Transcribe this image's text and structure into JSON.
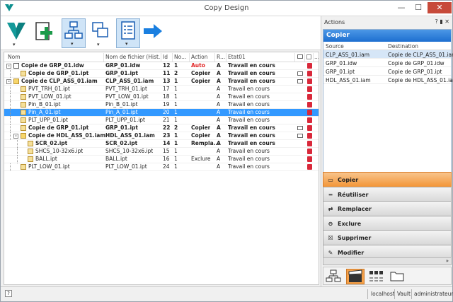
{
  "window": {
    "title": "Copy Design",
    "minimize": "—",
    "maximize": "☐",
    "close": "✕"
  },
  "toolbar": {
    "buttons": [
      {
        "name": "vault-menu",
        "icon": "vault-logo-icon"
      },
      {
        "name": "add",
        "icon": "add-plus-icon"
      },
      {
        "name": "tree-view",
        "icon": "tree-structure-icon"
      },
      {
        "name": "copy",
        "icon": "copy-windows-icon"
      },
      {
        "name": "list-view",
        "icon": "list-view-icon"
      },
      {
        "name": "next",
        "icon": "arrow-right-icon"
      }
    ]
  },
  "grid": {
    "headers": {
      "name": "Nom",
      "filename": "Nom de fichier (Hist...",
      "id": "Id",
      "no": "No...",
      "action": "Action",
      "r": "R...",
      "state": "Etat01",
      "more": "..."
    },
    "rows": [
      {
        "name": "Copie de GRP_01.idw",
        "file": "GRP_01.idw",
        "id": "12",
        "no": "1",
        "action": "Auto",
        "r": "A",
        "state": "Travail en cours",
        "bold": true,
        "red": true,
        "level": 0,
        "type": "drw",
        "exp": "-",
        "doc": false
      },
      {
        "name": "Copie de GRP_01.ipt",
        "file": "GRP_01.ipt",
        "id": "11",
        "no": "2",
        "action": "Copier",
        "r": "A",
        "state": "Travail en cours",
        "bold": true,
        "level": 1,
        "type": "pt",
        "doc": true
      },
      {
        "name": "Copie de CLP_ASS_01.iam",
        "file": "CLP_ASS_01.iam",
        "id": "13",
        "no": "1",
        "action": "Copier",
        "r": "A",
        "state": "Travail en cours",
        "bold": true,
        "level": 0,
        "type": "asm",
        "exp": "-",
        "doc": true
      },
      {
        "name": "PVT_TRH_01.ipt",
        "file": "PVT_TRH_01.ipt",
        "id": "17",
        "no": "1",
        "action": "",
        "r": "A",
        "state": "Travail en cours",
        "level": 1,
        "type": "pt"
      },
      {
        "name": "PVT_LOW_01.ipt",
        "file": "PVT_LOW_01.ipt",
        "id": "18",
        "no": "1",
        "action": "",
        "r": "A",
        "state": "Travail en cours",
        "level": 1,
        "type": "pt"
      },
      {
        "name": "Pin_B_01.ipt",
        "file": "Pin_B_01.ipt",
        "id": "19",
        "no": "1",
        "action": "",
        "r": "A",
        "state": "Travail en cours",
        "level": 1,
        "type": "pt"
      },
      {
        "name": "Pin_A_01.ipt",
        "file": "Pin_A_01.ipt",
        "id": "20",
        "no": "1",
        "action": "",
        "r": "A",
        "state": "Travail en cours",
        "level": 1,
        "type": "pt",
        "sel": true
      },
      {
        "name": "PLT_UPP_01.ipt",
        "file": "PLT_UPP_01.ipt",
        "id": "21",
        "no": "1",
        "action": "",
        "r": "A",
        "state": "Travail en cours",
        "level": 1,
        "type": "pt"
      },
      {
        "name": "Copie de GRP_01.ipt",
        "file": "GRP_01.ipt",
        "id": "22",
        "no": "2",
        "action": "Copier",
        "r": "A",
        "state": "Travail en cours",
        "bold": true,
        "level": 1,
        "type": "pt",
        "doc": true
      },
      {
        "name": "Copie de HDL_ASS_01.iam",
        "file": "HDL_ASS_01.iam",
        "id": "23",
        "no": "1",
        "action": "Copier",
        "r": "A",
        "state": "Travail en cours",
        "bold": true,
        "level": 1,
        "type": "asm",
        "exp": "-",
        "doc": true
      },
      {
        "name": "SCR_02.ipt",
        "file": "SCR_02.ipt",
        "id": "14",
        "no": "1",
        "action": "Rempla...",
        "r": "A",
        "state": "Travail en cours",
        "bold": true,
        "level": 2,
        "type": "pt"
      },
      {
        "name": "SHCS_10-32x6.ipt",
        "file": "SHCS_10-32x6.ipt",
        "id": "15",
        "no": "1",
        "action": "",
        "r": "A",
        "state": "Travail en cours",
        "level": 2,
        "type": "pt"
      },
      {
        "name": "BALL.ipt",
        "file": "BALL.ipt",
        "id": "16",
        "no": "1",
        "action": "Exclure",
        "r": "A",
        "state": "Travail en cours",
        "level": 2,
        "type": "pt"
      },
      {
        "name": "PLT_LOW_01.ipt",
        "file": "PLT_LOW_01.ipt",
        "id": "24",
        "no": "1",
        "action": "",
        "r": "A",
        "state": "Travail en cours",
        "level": 1,
        "type": "pt"
      }
    ]
  },
  "actions": {
    "title": "Actions",
    "help": "?",
    "pin": "▮",
    "close": "✕",
    "panel_title": "Copier",
    "col_source": "Source",
    "col_dest": "Destination",
    "rows": [
      {
        "source": "CLP_ASS_01.iam",
        "dest": "Copie de CLP_ASS_01.iam",
        "sel": true
      },
      {
        "source": "GRP_01.idw",
        "dest": "Copie de GRP_01.idw"
      },
      {
        "source": "GRP_01.ipt",
        "dest": "Copie de GRP_01.ipt"
      },
      {
        "source": "HDL_ASS_01.iam",
        "dest": "Copie de HDL_ASS_01.iam"
      }
    ],
    "buttons": [
      {
        "label": "Copier",
        "icon": "copy-icon",
        "active": true
      },
      {
        "label": "Réutiliser",
        "icon": "reuse-icon"
      },
      {
        "label": "Remplacer",
        "icon": "replace-icon"
      },
      {
        "label": "Exclure",
        "icon": "exclude-icon"
      },
      {
        "label": "Supprimer",
        "icon": "delete-icon"
      },
      {
        "label": "Modifier",
        "icon": "edit-icon"
      }
    ],
    "more": "»"
  },
  "statusbar": {
    "help": "?",
    "server": "localhost",
    "vault": "Vault",
    "user": "administrateur"
  }
}
